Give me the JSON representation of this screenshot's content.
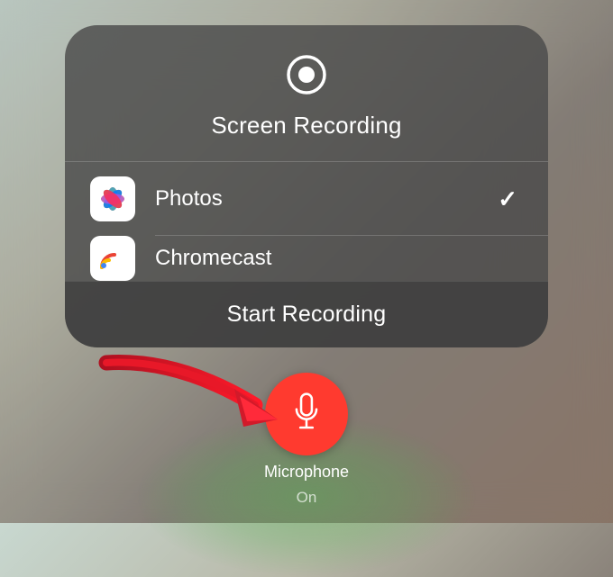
{
  "panel": {
    "title": "Screen Recording",
    "apps": [
      {
        "name": "Photos",
        "selected": true
      },
      {
        "name": "Chromecast",
        "selected": false
      }
    ],
    "action_label": "Start Recording"
  },
  "microphone": {
    "label": "Microphone",
    "state": "On",
    "color": "#ff3a2f"
  },
  "annotation": {
    "arrow_color": "#d11a2a"
  }
}
